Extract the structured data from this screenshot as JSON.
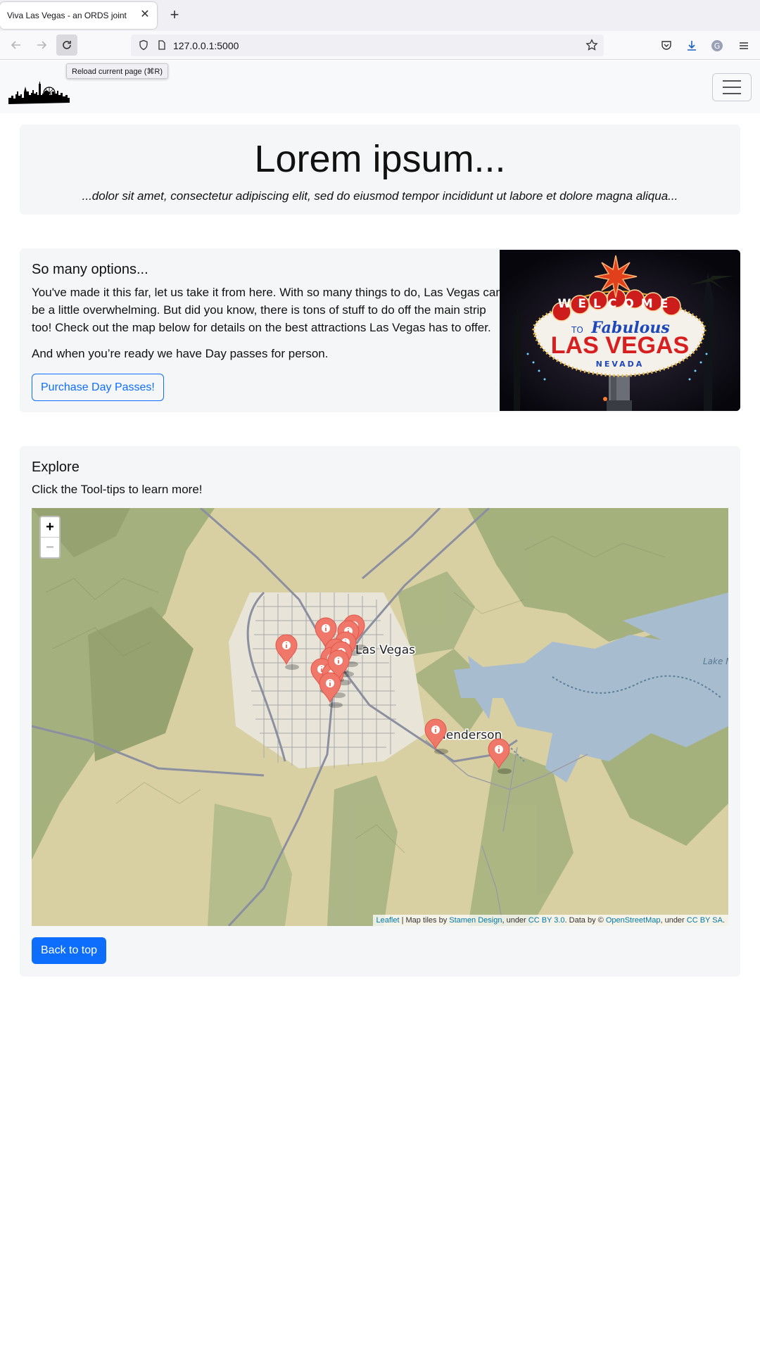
{
  "browser": {
    "tab_title": "Viva Las Vegas - an ORDS joint",
    "url": "127.0.0.1:5000",
    "tooltip": "Reload current page (⌘R)"
  },
  "hero": {
    "title": "Lorem ipsum...",
    "subtitle": "...dolor sit amet, consectetur adipiscing elit, sed do eiusmod tempor incididunt ut labore et dolore magna aliqua..."
  },
  "options": {
    "title": "So many options...",
    "text": "You've made it this far, let us take it from here. With so many things to do, Las Vegas can be a little overwhelming. But did you know, there is tons of stuff to do off the main strip too! Check out the map below for details on the best attractions Las Vegas has to offer.",
    "text2": "And when you’re ready we have Day passes for person.",
    "button": "Purchase Day Passes!",
    "sign": {
      "welcome": "WELCOME",
      "to": "TO",
      "fabulous": "Fabulous",
      "las_vegas": "LAS VEGAS",
      "nevada": "NEVADA"
    }
  },
  "explore": {
    "title": "Explore",
    "subtitle": "Click the Tool-tips to learn more!",
    "button": "Back to top",
    "map": {
      "zoom_in": "+",
      "zoom_out": "−",
      "label_las_vegas": "Las Vegas",
      "label_henderson": "Henderson",
      "label_lake": "Lake M",
      "attribution": {
        "leaflet": "Leaflet",
        "sep": " | Map tiles by ",
        "stamen": "Stamen Design",
        "under1": ", under ",
        "ccby": "CC BY 3.0",
        "data": ". Data by © ",
        "osm": "OpenStreetMap",
        "under2": ", under ",
        "ccbysa": "CC BY SA",
        "end": "."
      },
      "marker_count": 14,
      "marker_color": "#f0786a"
    }
  },
  "colors": {
    "primary": "#0d6efd",
    "panel": "#f5f6f8",
    "water": "#a4b8cc",
    "park": "#9eab78"
  }
}
